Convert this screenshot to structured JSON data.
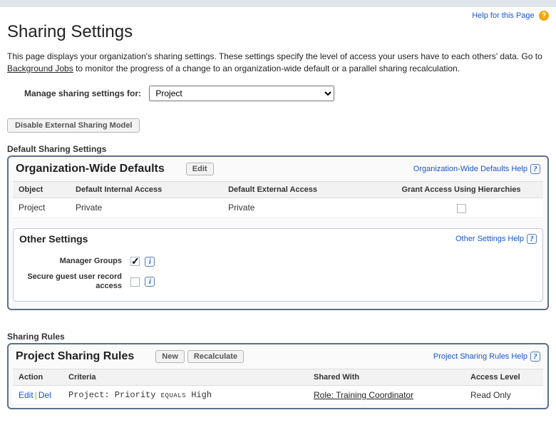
{
  "help_for_page": "Help for this Page",
  "title": "Sharing Settings",
  "intro_1": "This page displays your organization's sharing settings. These settings specify the level of access your users have to each others' data. Go to ",
  "intro_link": "Background Jobs",
  "intro_2": " to monitor the progress of a change to an organization-wide default or a parallel sharing recalculation.",
  "manage_label": "Manage sharing settings for:",
  "manage_value": "Project",
  "disable_btn": "Disable External Sharing Model",
  "default_section": "Default Sharing Settings",
  "owd": {
    "title": "Organization-Wide Defaults",
    "edit_btn": "Edit",
    "help": "Organization-Wide Defaults Help",
    "cols": {
      "object": "Object",
      "internal": "Default Internal Access",
      "external": "Default External Access",
      "grant": "Grant Access Using Hierarchies"
    },
    "rows": [
      {
        "object": "Project",
        "internal": "Private",
        "external": "Private",
        "grant": false
      }
    ]
  },
  "other": {
    "title": "Other Settings",
    "help": "Other Settings Help",
    "rows": [
      {
        "label": "Manager Groups",
        "checked": true
      },
      {
        "label": "Secure guest user record access",
        "checked": false
      }
    ]
  },
  "rules_section": "Sharing Rules",
  "rules": {
    "title": "Project Sharing Rules",
    "new_btn": "New",
    "recalc_btn": "Recalculate",
    "help": "Project Sharing Rules Help",
    "cols": {
      "action": "Action",
      "criteria": "Criteria",
      "shared": "Shared With",
      "access": "Access Level"
    },
    "rows": [
      {
        "edit": "Edit",
        "del": "Del",
        "crit_pre": "Project: Priority",
        "crit_op": "EQUALS",
        "crit_val": "High",
        "shared": "Role: Training Coordinator",
        "access": "Read Only"
      }
    ]
  }
}
